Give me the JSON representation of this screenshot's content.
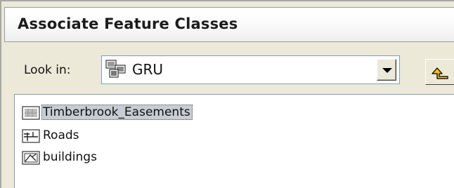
{
  "dialog": {
    "title": "Associate Feature Classes"
  },
  "look_in": {
    "label": "Look in:",
    "value": "GRU",
    "icon": "folder-db-icon"
  },
  "toolbar": {
    "up_icon": "up-one-level-icon"
  },
  "file_list": [
    {
      "name": "Timberbrook_Easements",
      "icon": "polygon-feature-class-icon",
      "selected": true
    },
    {
      "name": "Roads",
      "icon": "line-feature-class-icon",
      "selected": false
    },
    {
      "name": "buildings",
      "icon": "annotation-feature-class-icon",
      "selected": false
    }
  ],
  "colors": {
    "selection": "#c9ccd4",
    "dialog_bg": "#ece9d8",
    "border": "#7f9db9"
  }
}
